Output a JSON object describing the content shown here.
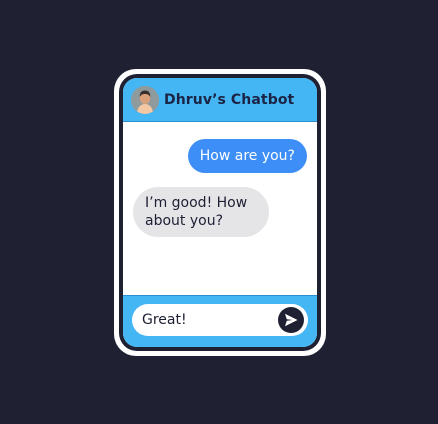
{
  "header": {
    "title": "Dhruv’s Chatbot",
    "avatar_icon": "user-avatar-icon"
  },
  "messages": [
    {
      "from": "user",
      "text": "How are you?"
    },
    {
      "from": "bot",
      "text": "I’m good! How about you?"
    }
  ],
  "composer": {
    "value": "Great!",
    "send_icon": "send-arrow-icon"
  },
  "colors": {
    "background": "#1f2133",
    "accent": "#45b6f4",
    "user_bubble": "#3d8ef7",
    "bot_bubble": "#e5e5e8"
  }
}
